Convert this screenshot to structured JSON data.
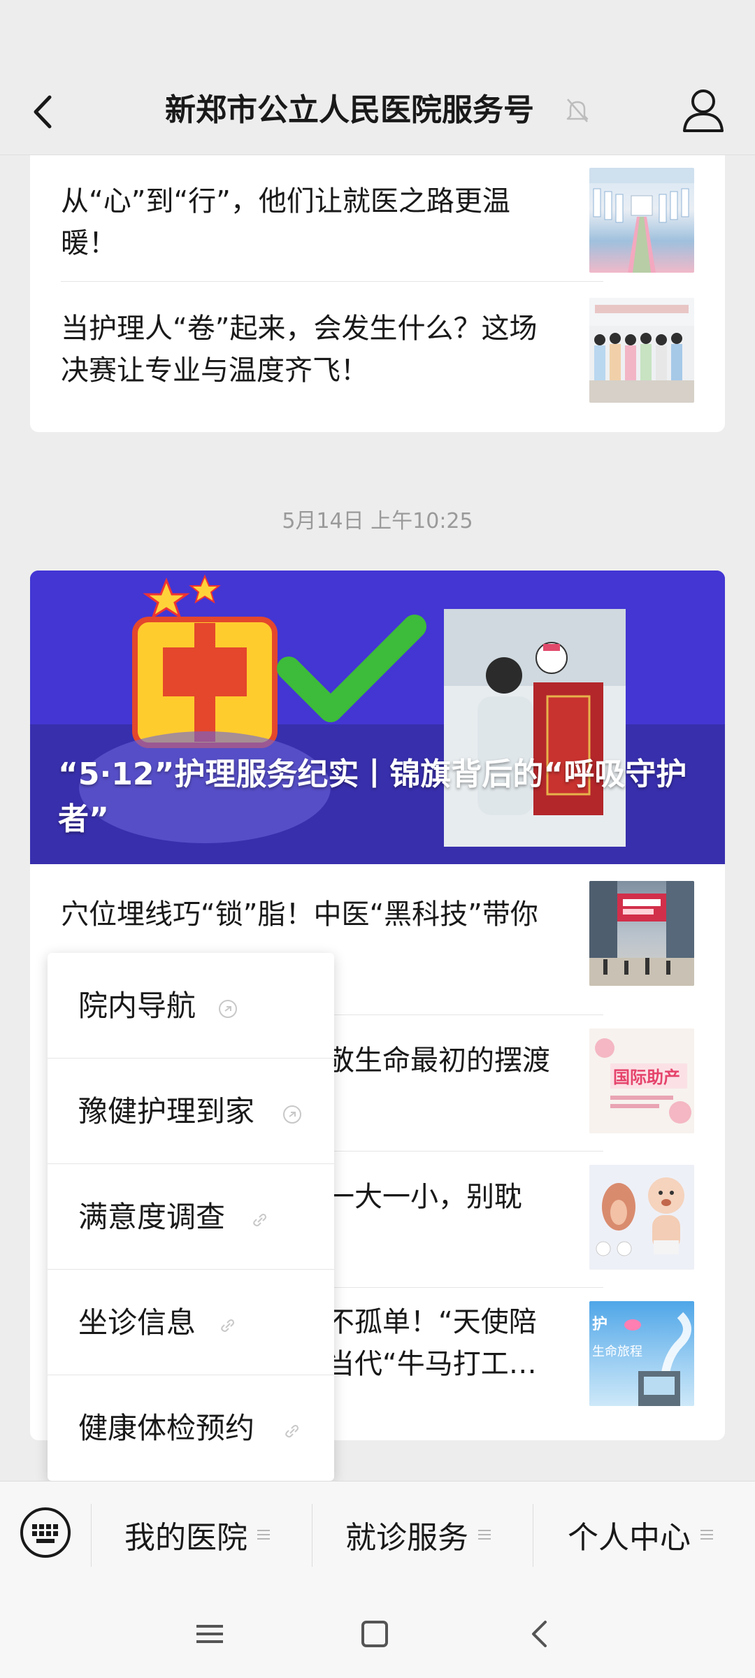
{
  "header": {
    "title": "新郑市公立人民医院服务号"
  },
  "card1": {
    "items": [
      {
        "title": "从“心”到“行”，他们让就医之路更温暖！"
      },
      {
        "title": "当护理人“卷”起来，会发生什么？这场决赛让专业与温度齐飞！"
      }
    ]
  },
  "timestamp": "5月14日 上午10:25",
  "card2": {
    "hero_title": "“5·12”护理服务纪实丨锦旗背后的“呼吸守护者”",
    "items": [
      {
        "title": "穴位埋线巧“锁”脂！中医“黑科技”带你"
      },
      {
        "title": "敬生命最初的摆渡"
      },
      {
        "title": "一大一小，别耽"
      },
      {
        "title": "不孤单！“天使陪\n当代“牛马打工…"
      }
    ]
  },
  "popup_menu": {
    "items": [
      "院内导航",
      "豫健护理到家",
      "满意度调查",
      "坐诊信息",
      "健康体检预约"
    ]
  },
  "bottom_menu": {
    "items": [
      "我的医院",
      "就诊服务",
      "个人中心"
    ]
  },
  "colors": {
    "background": "#ededed",
    "hero": "#3b2fc8",
    "text": "#191919",
    "muted": "#9a9a9a"
  },
  "icons": {
    "back": "chevron-left-icon",
    "mute": "bell-muted-icon",
    "profile": "user-icon",
    "keyboard": "keyboard-icon",
    "link": "link-icon"
  }
}
